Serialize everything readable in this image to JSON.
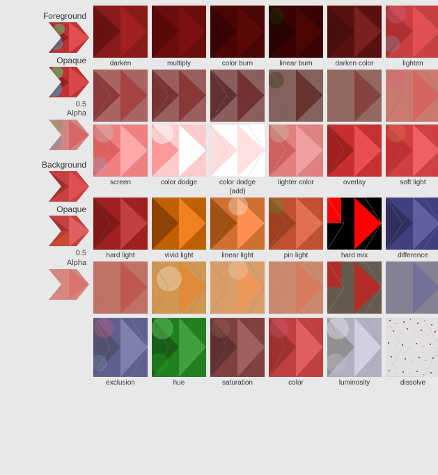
{
  "labels": {
    "foreground": "Foreground",
    "background": "Background",
    "opaque": "Opaque",
    "alpha": "0.5\nAlpha"
  },
  "blendModes": {
    "row1": [
      {
        "name": "darken",
        "class": "blend-darken"
      },
      {
        "name": "multiply",
        "class": "blend-multiply"
      },
      {
        "name": "color burn",
        "class": "blend-colorburn"
      },
      {
        "name": "linear burn",
        "class": "blend-linearburn"
      },
      {
        "name": "darken color",
        "class": "blend-darkencolor"
      },
      {
        "name": "lighten",
        "class": "blend-lighten"
      }
    ],
    "row2": [
      {
        "name": "screen",
        "class": "blend-screen"
      },
      {
        "name": "color dodge",
        "class": "blend-colordodge"
      },
      {
        "name": "color dodge\n(add)",
        "class": "blend-colordodgeadd"
      },
      {
        "name": "lighter color",
        "class": "blend-lightercolor"
      },
      {
        "name": "overlay",
        "class": "blend-overlay"
      },
      {
        "name": "soft light",
        "class": "blend-softlight"
      }
    ],
    "row3": [
      {
        "name": "hard light",
        "class": "blend-hardlight"
      },
      {
        "name": "vivid light",
        "class": "blend-vividlight"
      },
      {
        "name": "linear light",
        "class": "blend-linearlight"
      },
      {
        "name": "pin light",
        "class": "blend-pinlight"
      },
      {
        "name": "hard mix",
        "class": "blend-hardmix"
      },
      {
        "name": "difference",
        "class": "blend-difference"
      }
    ],
    "row4": [
      {
        "name": "exclusion",
        "class": "blend-exclusion"
      },
      {
        "name": "hue",
        "class": "blend-hue"
      },
      {
        "name": "saturation",
        "class": "blend-saturation"
      },
      {
        "name": "color",
        "class": "blend-color"
      },
      {
        "name": "luminosity",
        "class": "blend-luminosity"
      },
      {
        "name": "dissolve",
        "class": "blend-dissolve"
      }
    ]
  }
}
